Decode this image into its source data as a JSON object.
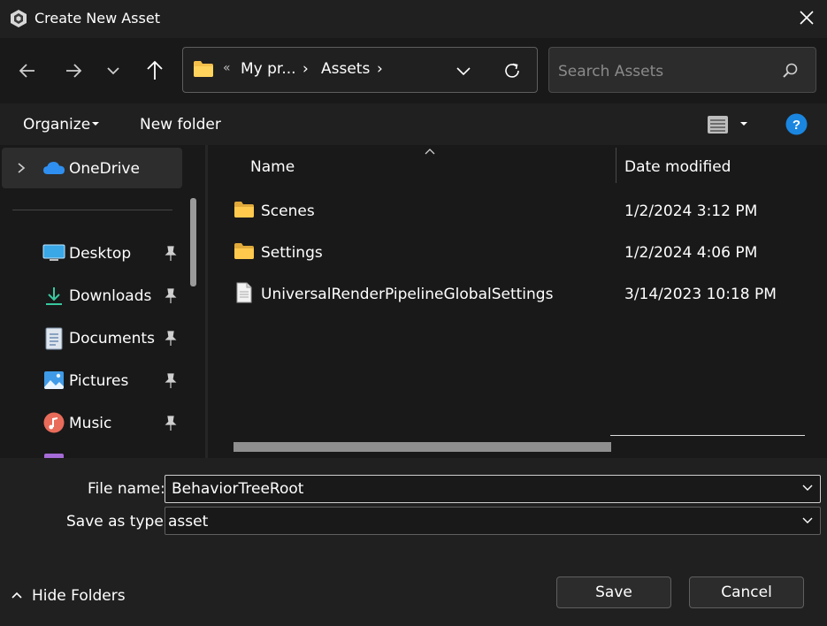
{
  "window": {
    "title": "Create New Asset",
    "icon": "unity-icon"
  },
  "address_bar": {
    "overflow": "«",
    "crumbs": [
      "My pr...",
      "Assets"
    ],
    "separator": "›"
  },
  "search": {
    "placeholder": "Search Assets"
  },
  "toolbar": {
    "organize_label": "Organize",
    "new_folder_label": "New folder"
  },
  "sidebar": {
    "items": [
      {
        "label": "OneDrive",
        "icon": "onedrive-icon",
        "selected": true
      },
      {
        "label": "Desktop",
        "icon": "desktop-icon",
        "pinned": true
      },
      {
        "label": "Downloads",
        "icon": "downloads-icon",
        "pinned": true
      },
      {
        "label": "Documents",
        "icon": "documents-icon",
        "pinned": true
      },
      {
        "label": "Pictures",
        "icon": "pictures-icon",
        "pinned": true
      },
      {
        "label": "Music",
        "icon": "music-icon",
        "pinned": true
      }
    ]
  },
  "file_list": {
    "columns": [
      "Name",
      "Date modified"
    ],
    "rows": [
      {
        "name": "Scenes",
        "date": "1/2/2024 3:12 PM",
        "type": "folder"
      },
      {
        "name": "Settings",
        "date": "1/2/2024 4:06 PM",
        "type": "folder"
      },
      {
        "name": "UniversalRenderPipelineGlobalSettings",
        "date": "3/14/2023 10:18 PM",
        "type": "file"
      }
    ]
  },
  "form": {
    "file_name_label": "File name:",
    "file_name_value": "BehaviorTreeRoot",
    "save_type_label": "Save as type:",
    "save_type_value": "asset"
  },
  "footer": {
    "hide_folders_label": "Hide Folders",
    "save_label": "Save",
    "cancel_label": "Cancel"
  },
  "colors": {
    "folder": "#f5c04a",
    "onedrive": "#2f8ff0",
    "help": "#1a86e0",
    "download_arrow": "#39c8a0"
  }
}
